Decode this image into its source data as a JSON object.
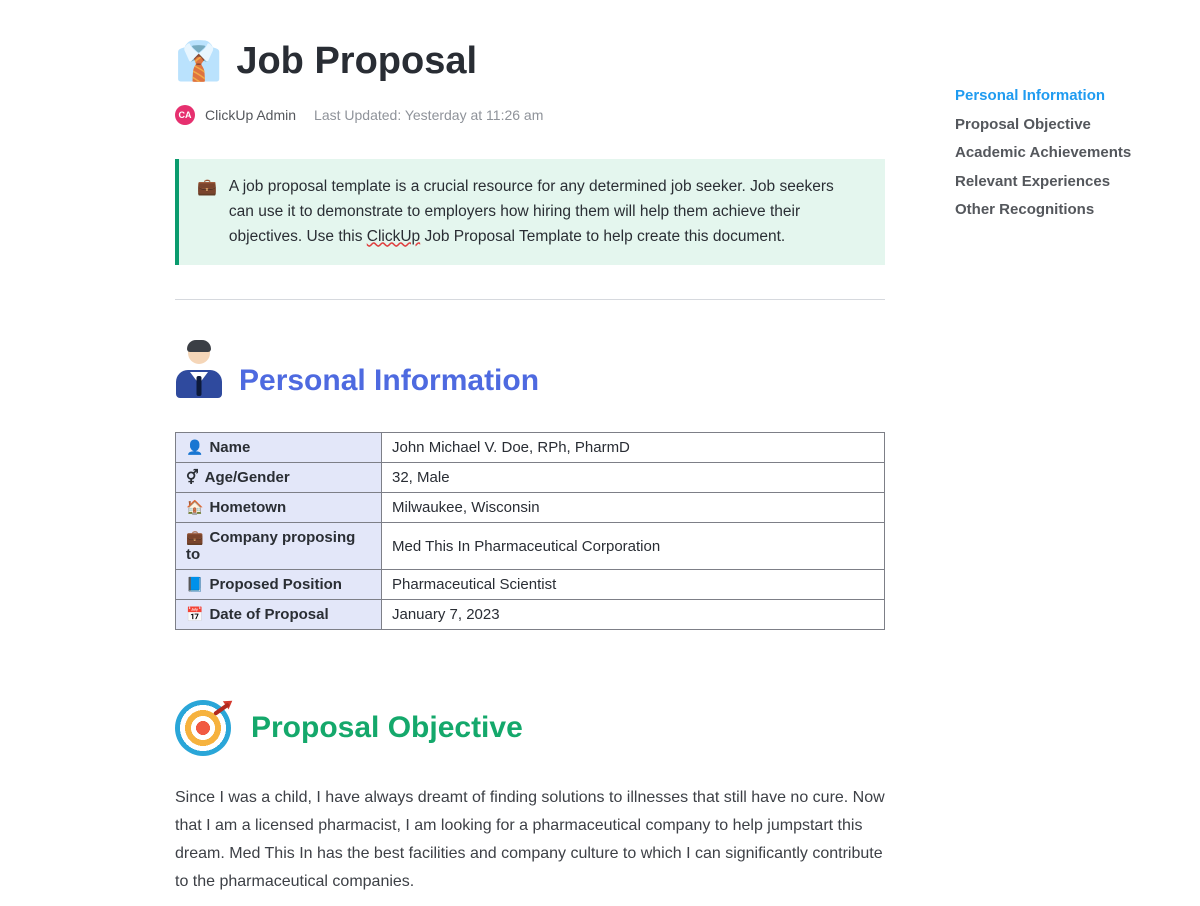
{
  "header": {
    "icon": "👔",
    "title": "Job Proposal",
    "avatar_initials": "CA",
    "author": "ClickUp Admin",
    "last_updated_prefix": "Last Updated: ",
    "last_updated_value": "Yesterday at 11:26 am"
  },
  "callout": {
    "emoji": "💼",
    "text_before": "A job proposal template is a crucial resource for any determined job seeker. Job seekers can use it to demonstrate to employers how hiring them will help them achieve their objectives. Use this ",
    "link_text": "ClickUp",
    "text_after": " Job Proposal Template to help create this document."
  },
  "nav": {
    "items": [
      {
        "label": "Personal Information",
        "active": true
      },
      {
        "label": "Proposal Objective",
        "active": false
      },
      {
        "label": "Academic Achievements",
        "active": false
      },
      {
        "label": "Relevant Experiences",
        "active": false
      },
      {
        "label": "Other Recognitions",
        "active": false
      }
    ]
  },
  "sections": {
    "personal_info": {
      "heading": "Personal Information",
      "rows": [
        {
          "icon": "👤",
          "label": "Name",
          "value": "John Michael V. Doe, RPh, PharmD"
        },
        {
          "icon": "⚥",
          "label": "Age/Gender",
          "value": "32, Male"
        },
        {
          "icon": "🏠",
          "label": "Hometown",
          "value": "Milwaukee, Wisconsin"
        },
        {
          "icon": "💼",
          "label": "Company proposing to",
          "value": "Med This In Pharmaceutical Corporation"
        },
        {
          "icon": "📘",
          "label": "Proposed Position",
          "value": "Pharmaceutical Scientist"
        },
        {
          "icon": "📅",
          "label": "Date of Proposal",
          "value": "January 7, 2023"
        }
      ]
    },
    "proposal_objective": {
      "heading": "Proposal Objective",
      "body": "Since I was a child, I have always dreamt of finding solutions to illnesses that still have no cure. Now that I am a licensed pharmacist, I am looking for a pharmaceutical company to help jumpstart this dream. Med This In has the best facilities and company culture to which I can significantly contribute to the pharmaceutical companies."
    }
  }
}
